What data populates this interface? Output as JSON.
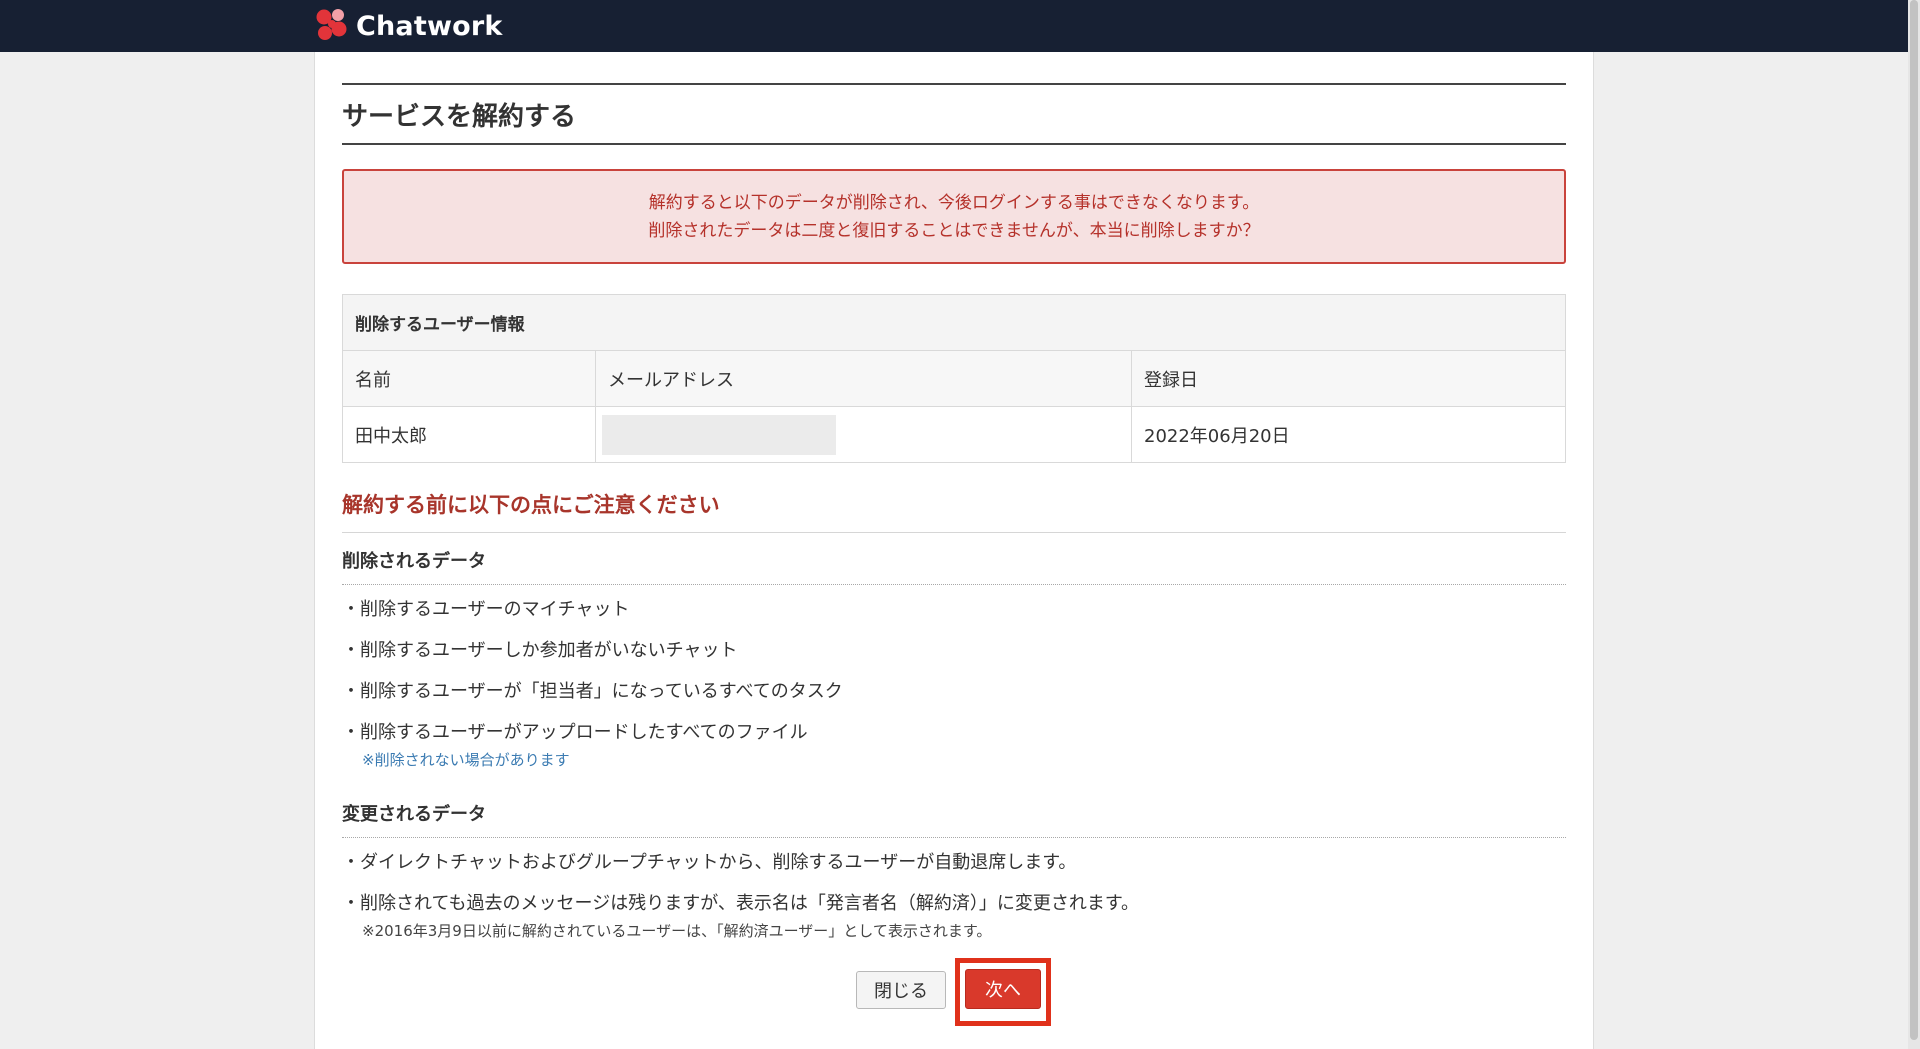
{
  "header": {
    "brand": "Chatwork",
    "logo_icon": "chatwork-flower-icon",
    "brand_colors": [
      "#e2343a",
      "#f2a0a8"
    ]
  },
  "page": {
    "title": "サービスを解約する"
  },
  "alert": {
    "line1": "解約すると以下のデータが削除され、今後ログインする事はできなくなります。",
    "line2": "削除されたデータは二度と復旧することはできませんが、本当に削除しますか？"
  },
  "user_table": {
    "caption": "削除するユーザー情報",
    "headers": [
      "名前",
      "メールアドレス",
      "登録日"
    ],
    "row": {
      "name": "田中太郎",
      "email": "",
      "registered": "2022年06月20日"
    }
  },
  "caution": {
    "heading": "解約する前に以下の点にご注意ください"
  },
  "deleted_data": {
    "heading": "削除されるデータ",
    "items": [
      "・削除するユーザーのマイチャット",
      "・削除するユーザーしか参加者がいないチャット",
      "・削除するユーザーが「担当者」になっているすべてのタスク",
      "・削除するユーザーがアップロードしたすべてのファイル"
    ],
    "note": "※削除されない場合があります"
  },
  "changed_data": {
    "heading": "変更されるデータ",
    "items": [
      "・ダイレクトチャットおよびグループチャットから、削除するユーザーが自動退席します。",
      "・削除されても過去のメッセージは残りますが、表示名は「発言者名（解約済）」に変更されます。"
    ],
    "note": "※2016年3月9日以前に解約されているユーザーは、「解約済ユーザー」として表示されます。"
  },
  "actions": {
    "close_label": "閉じる",
    "next_label": "次へ"
  },
  "colors": {
    "header_bg": "#172033",
    "accent_red": "#d9392b",
    "warning_text": "#a8352b",
    "alert_bg": "#f6e1e1",
    "link_blue": "#3b7bb2"
  }
}
